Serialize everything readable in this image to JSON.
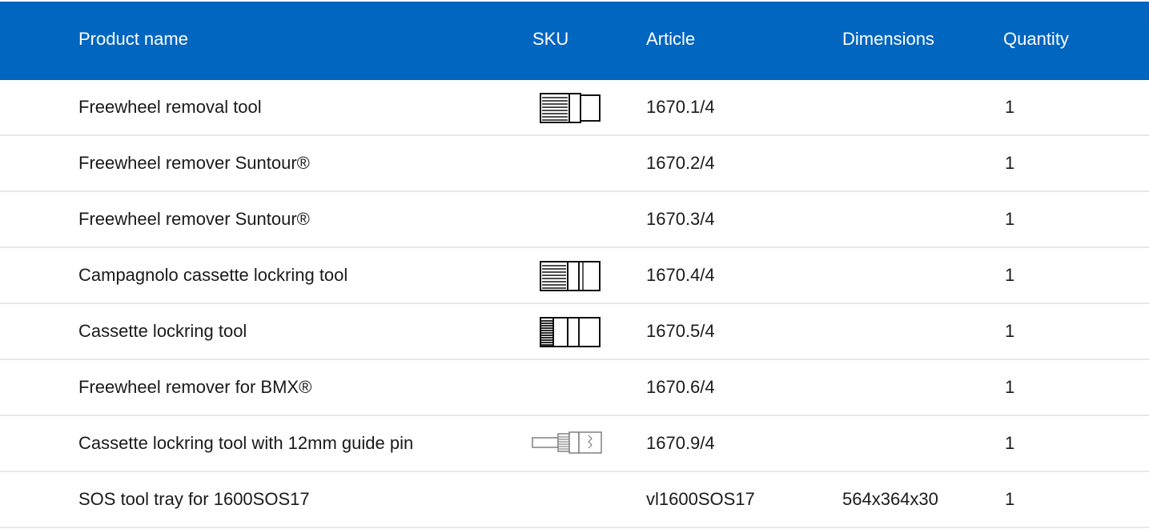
{
  "table": {
    "headers": {
      "product_name": "Product name",
      "sku": "SKU",
      "article": "Article",
      "dimensions": "Dimensions",
      "quantity": "Quantity"
    },
    "rows": [
      {
        "name": "Freewheel removal tool",
        "sku_icon": "freewheel-tool-icon",
        "article": "1670.1/4",
        "dimensions": "",
        "quantity": "1"
      },
      {
        "name": "Freewheel remover Suntour®",
        "sku_icon": "",
        "article": "1670.2/4",
        "dimensions": "",
        "quantity": "1"
      },
      {
        "name": "Freewheel remover Suntour®",
        "sku_icon": "",
        "article": "1670.3/4",
        "dimensions": "",
        "quantity": "1"
      },
      {
        "name": "Campagnolo cassette lockring tool",
        "sku_icon": "lockring-tool-icon",
        "article": "1670.4/4",
        "dimensions": "",
        "quantity": "1"
      },
      {
        "name": "Cassette lockring tool",
        "sku_icon": "lockring-tool-icon",
        "article": "1670.5/4",
        "dimensions": "",
        "quantity": "1"
      },
      {
        "name": "Freewheel remover for BMX®",
        "sku_icon": "",
        "article": "1670.6/4",
        "dimensions": "",
        "quantity": "1"
      },
      {
        "name": "Cassette lockring tool with 12mm guide pin",
        "sku_icon": "guide-pin-tool-icon",
        "article": "1670.9/4",
        "dimensions": "",
        "quantity": "1"
      },
      {
        "name": "SOS tool tray for 1600SOS17",
        "sku_icon": "",
        "article": "vl1600SOS17",
        "dimensions": "564x364x30",
        "quantity": "1"
      }
    ]
  },
  "colors": {
    "header_bg": "#0066c0",
    "header_text": "#ffffff",
    "row_divider": "#e8e8e8"
  }
}
